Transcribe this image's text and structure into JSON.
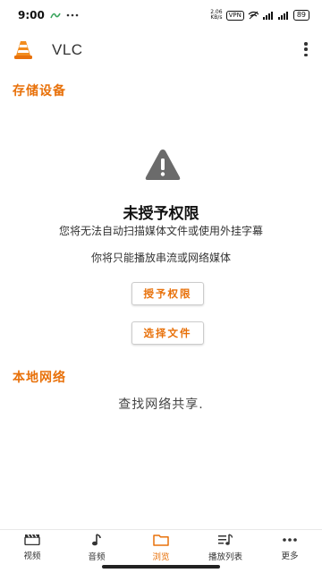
{
  "status_bar": {
    "time": "9:00",
    "notif_icons": "ᵃ ···",
    "net_speed": "2.06\nKB/s",
    "vpn": "VPN",
    "battery": "89"
  },
  "app_bar": {
    "title": "VLC",
    "accent": "#e8710a"
  },
  "storage_section": {
    "title": "存储设备",
    "empty_title": "未授予权限",
    "empty_desc_1": "您将无法自动扫描媒体文件或使用外挂字幕",
    "empty_desc_2": "你将只能播放串流或网络媒体",
    "grant_button": "授予权限",
    "pick_file_button": "选择文件"
  },
  "network_section": {
    "title": "本地网络",
    "empty_text": "查找网络共享."
  },
  "bottom_nav": {
    "items": [
      {
        "label": "视频",
        "icon": "video-clapper-icon",
        "active": false
      },
      {
        "label": "音频",
        "icon": "music-note-icon",
        "active": false
      },
      {
        "label": "浏览",
        "icon": "folder-icon",
        "active": true
      },
      {
        "label": "播放列表",
        "icon": "playlist-icon",
        "active": false
      },
      {
        "label": "更多",
        "icon": "more-dots-icon",
        "active": false
      }
    ]
  }
}
